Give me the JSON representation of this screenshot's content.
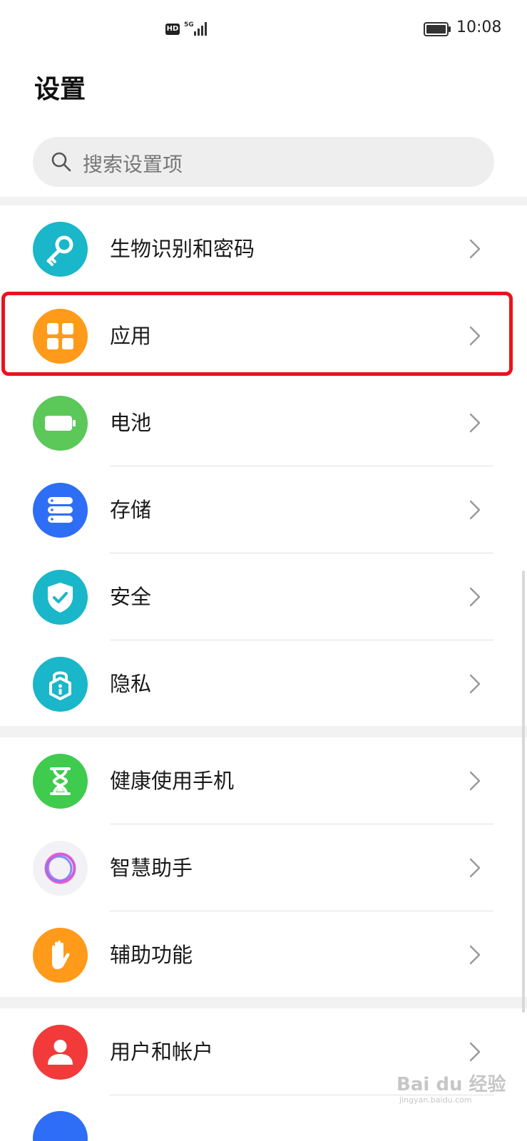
{
  "status_bar": {
    "hd_label": "HD",
    "network_label": "5G",
    "time": "10:08",
    "icons": [
      "hd-icon",
      "signal-icon",
      "battery-icon"
    ]
  },
  "page": {
    "title": "设置"
  },
  "search": {
    "placeholder": "搜索设置项",
    "icon": "search-icon"
  },
  "colors": {
    "biometrics": "#1ab6c9",
    "apps": "#ff9a1a",
    "battery": "#5cc85a",
    "storage": "#2e6df6",
    "security": "#1ab6c9",
    "privacy": "#1ab6c9",
    "digital_balance": "#3ecb4e",
    "assistant": "#f2f2f6",
    "accessibility": "#ff9a1a",
    "accounts": "#f23a3a",
    "highlight": "#e8141c"
  },
  "settings": {
    "items": [
      {
        "label": "生物识别和密码",
        "icon": "key-icon"
      },
      {
        "label": "应用",
        "icon": "apps-grid-icon",
        "highlighted": true
      },
      {
        "label": "电池",
        "icon": "battery-icon"
      },
      {
        "label": "存储",
        "icon": "storage-icon"
      },
      {
        "label": "安全",
        "icon": "shield-check-icon"
      },
      {
        "label": "隐私",
        "icon": "privacy-lock-icon"
      },
      {
        "label": "健康使用手机",
        "icon": "hourglass-icon"
      },
      {
        "label": "智慧助手",
        "icon": "assistant-ring-icon"
      },
      {
        "label": "辅助功能",
        "icon": "hand-icon"
      },
      {
        "label": "用户和帐户",
        "icon": "user-icon"
      }
    ]
  },
  "watermark": {
    "text": "Bai du 经验",
    "sub": "jingyan.baidu.com"
  }
}
